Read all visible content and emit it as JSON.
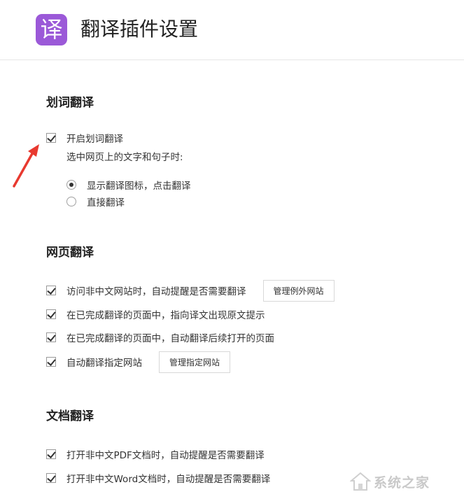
{
  "header": {
    "logo_char": "译",
    "title": "翻译插件设置"
  },
  "sections": {
    "word_translate": {
      "title": "划词翻译",
      "enable_label": "开启划词翻译",
      "enable_checked": true,
      "prompt": "选中网页上的文字和句子时:",
      "options": [
        {
          "label": "显示翻译图标，点击翻译",
          "selected": true
        },
        {
          "label": "直接翻译",
          "selected": false
        }
      ]
    },
    "page_translate": {
      "title": "网页翻译",
      "items": [
        {
          "label": "访问非中文网站时，自动提醒是否需要翻译",
          "checked": true,
          "button": "管理例外网站"
        },
        {
          "label": "在已完成翻译的页面中，指向译文出现原文提示",
          "checked": true
        },
        {
          "label": "在已完成翻译的页面中，自动翻译后续打开的页面",
          "checked": true
        },
        {
          "label": "自动翻译指定网站",
          "checked": true,
          "button": "管理指定网站"
        }
      ]
    },
    "doc_translate": {
      "title": "文档翻译",
      "items": [
        {
          "label": "打开非中文PDF文档时，自动提醒是否需要翻译",
          "checked": true
        },
        {
          "label": "打开非中文Word文档时，自动提醒是否需要翻译",
          "checked": true
        }
      ]
    }
  },
  "annotation": {
    "arrow_color": "#e8392f"
  },
  "watermark": {
    "text": "系统之家"
  }
}
